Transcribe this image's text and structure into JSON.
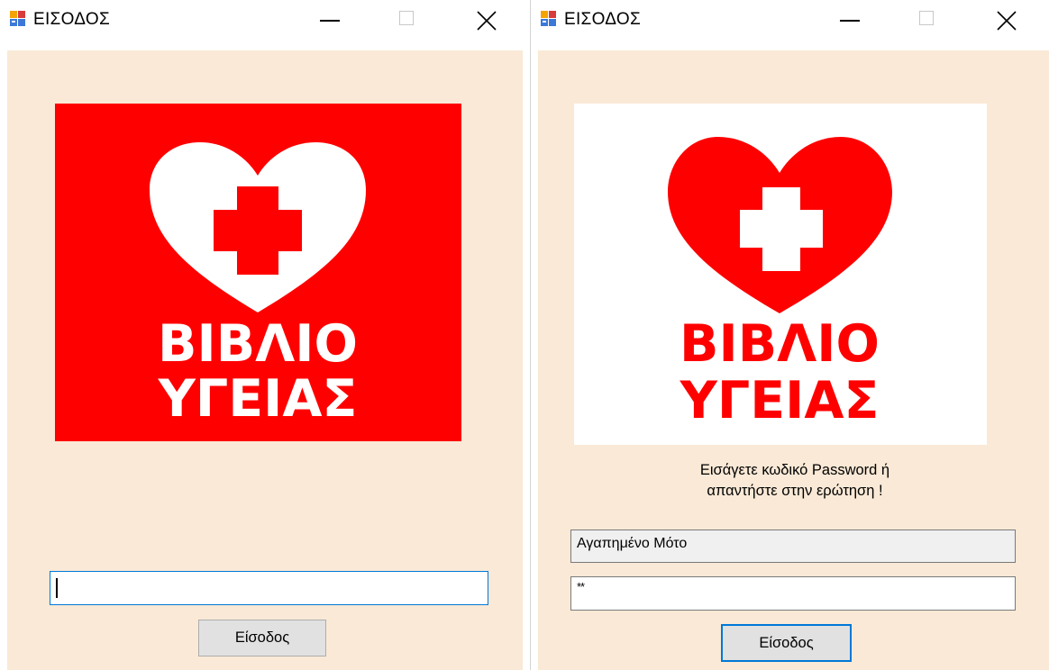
{
  "windows": [
    {
      "title": "ΕΙΣΟΔΟΣ",
      "logo": {
        "line1": "ΒΙΒΛΙΟ",
        "line2": "ΥΓΕΙΑΣ",
        "background": "#ff0000",
        "heart_color": "#ffffff",
        "cross_color": "#ff0000",
        "text_color": "#ffffff"
      },
      "password_field": {
        "value": ""
      },
      "login_button": "Είσοδος"
    },
    {
      "title": "ΕΙΣΟΔΟΣ",
      "logo": {
        "line1": "ΒΙΒΛΙΟ",
        "line2": "ΥΓΕΙΑΣ",
        "background": "#ffffff",
        "heart_color": "#ff0000",
        "cross_color": "#ffffff",
        "text_color": "#ff0000"
      },
      "prompt": {
        "line1": "Εισάγετε κωδικό Password ή",
        "line2": "απαντήστε στην ερώτηση !"
      },
      "question_field": {
        "value": "Αγαπημένο Μότο"
      },
      "password_field": {
        "value": "**"
      },
      "login_button": "Είσοδος"
    }
  ],
  "colors": {
    "client_background": "#f9e9d6",
    "focus_accent": "#0078d7"
  },
  "icons": {
    "app": "windows-form-icon",
    "minimize": "minimize-icon",
    "maximize": "maximize-icon",
    "close": "close-icon"
  }
}
